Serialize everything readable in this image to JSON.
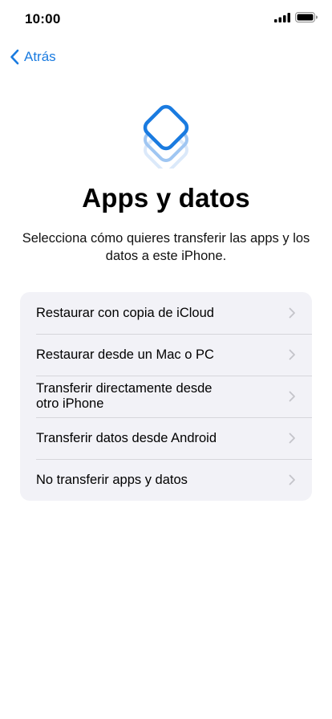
{
  "status_bar": {
    "time": "10:00",
    "icons": [
      "signal-icon",
      "battery-icon"
    ]
  },
  "nav": {
    "back_label": "Atrás",
    "back_icon": "chevron-left-icon"
  },
  "header": {
    "icon": "stacked-layers-icon",
    "title": "Apps y datos",
    "subtitle": "Selecciona cómo quieres transferir las apps y los datos a este iPhone."
  },
  "options": [
    {
      "label": "Restaurar con copia de iCloud"
    },
    {
      "label": "Restaurar desde un Mac o PC"
    },
    {
      "label": "Transferir directamente desde otro iPhone"
    },
    {
      "label": "Transferir datos desde Android"
    },
    {
      "label": "No transferir apps y datos"
    }
  ],
  "colors": {
    "accent": "#1a7be0",
    "list_background": "#f2f2f7",
    "chevron": "#c4c4c9"
  }
}
